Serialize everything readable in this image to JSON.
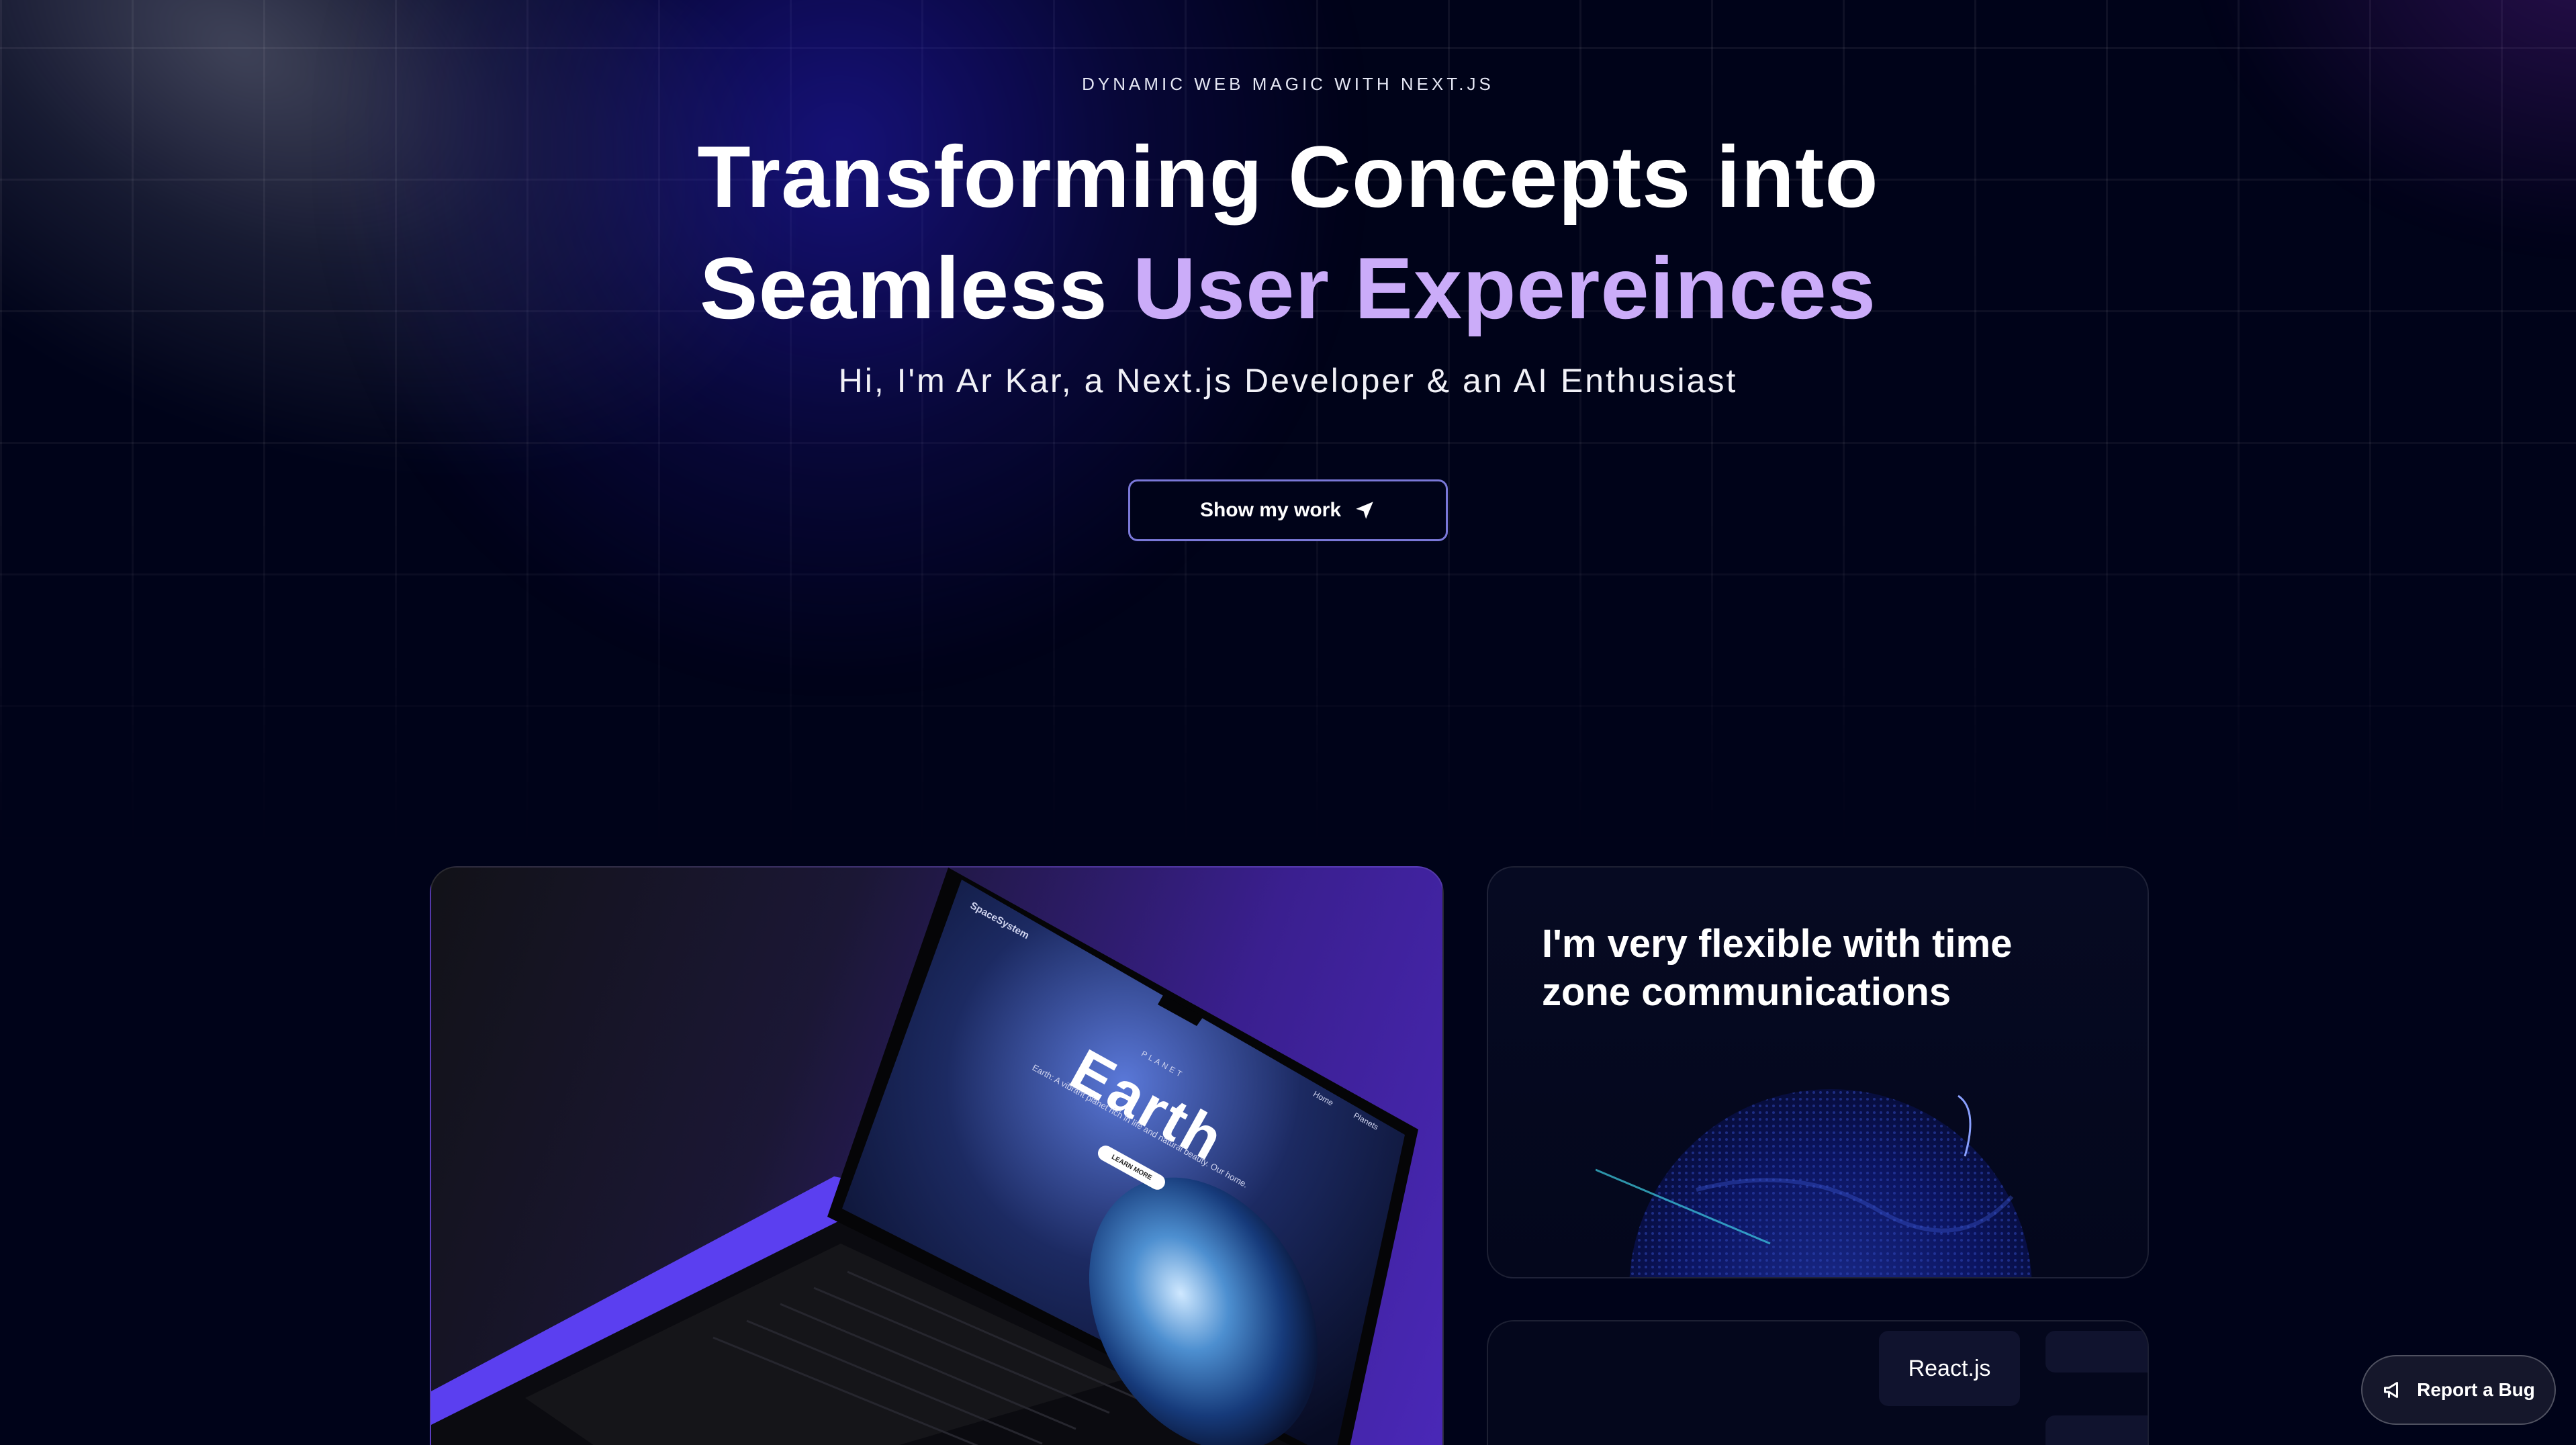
{
  "hero": {
    "eyebrow": "DYNAMIC WEB MAGIC WITH NEXT.JS",
    "headline_line1": "Transforming Concepts into",
    "headline_line2_plain": "Seamless ",
    "headline_line2_accent": "User Expereinces",
    "subtitle": "Hi, I'm Ar Kar, a Next.js Developer & an AI Enthusiast",
    "cta_label": "Show my work",
    "cta_icon": "location-arrow-icon"
  },
  "laptop_card": {
    "screen_brand": "SpaceSystem",
    "screen_nav": [
      "Home",
      "Planets"
    ],
    "screen_kicker": "PLANET",
    "screen_title": "Earth",
    "screen_tagline": "Earth: A vibrant planet rich in life and natural beauty. Our home.",
    "screen_button": "LEARN MORE"
  },
  "timezone_card": {
    "title": "I'm very flexible with time zone communications"
  },
  "stack_card": {
    "tags": [
      "React.js"
    ]
  },
  "report_bug": {
    "label": "Report a Bug",
    "icon": "megaphone-icon"
  },
  "colors": {
    "background": "#000319",
    "accent_purple": "#cbacf9",
    "cta_border": "#7a78d8",
    "card_purple": "#4a28b8"
  }
}
